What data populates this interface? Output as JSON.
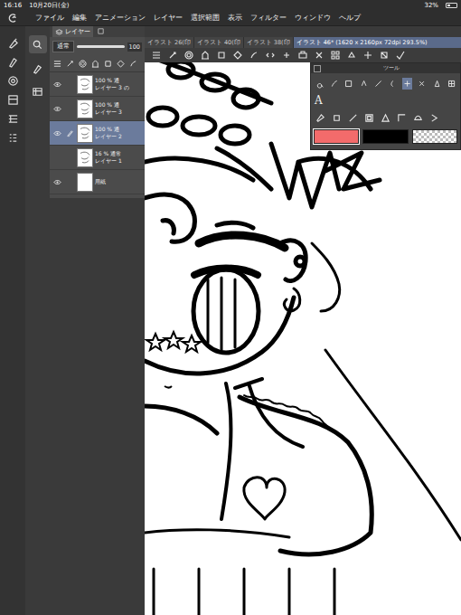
{
  "status_bar": {
    "time": "16:16",
    "date": "10月20日(金)",
    "battery": "32%",
    "battery_level": 0.32
  },
  "menu": [
    "ファイル",
    "編集",
    "アニメーション",
    "レイヤー",
    "選択範囲",
    "表示",
    "フィルター",
    "ウィンドウ",
    "ヘルプ"
  ],
  "layer_panel": {
    "tab": "レイヤー",
    "blend_mode": "通常",
    "opacity": "100",
    "layers": [
      {
        "kind": "raster",
        "opacity": "100 %",
        "mode": "通",
        "name": "レイヤー 3 の",
        "visible": true,
        "selected": false,
        "editing": false
      },
      {
        "kind": "raster",
        "opacity": "100 %",
        "mode": "通",
        "name": "レイヤー 3",
        "visible": true,
        "selected": false,
        "editing": false
      },
      {
        "kind": "raster",
        "opacity": "100 %",
        "mode": "通",
        "name": "レイヤー 2",
        "visible": true,
        "selected": true,
        "editing": true
      },
      {
        "kind": "raster",
        "opacity": "16 %",
        "mode": "通常",
        "name": "レイヤー 1",
        "visible": false,
        "selected": false,
        "editing": false
      },
      {
        "kind": "paper",
        "opacity": "",
        "mode": "",
        "name": "用紙",
        "visible": true,
        "selected": false,
        "editing": false
      }
    ]
  },
  "document_tabs": [
    {
      "label": "イラスト 26(印",
      "selected": false
    },
    {
      "label": "イラスト 40(印",
      "selected": false
    },
    {
      "label": "イラスト 38(印",
      "selected": false
    },
    {
      "label": "イラスト 46* (1620 x 2160px 72dpi 293.5%)",
      "selected": true
    }
  ],
  "tool_palette": {
    "title": "ツール",
    "text_tool": "A",
    "colors": [
      {
        "name": "main",
        "color": "#f36b6b",
        "selected": true
      },
      {
        "name": "sub",
        "color": "#000000",
        "selected": false
      },
      {
        "name": "transparent",
        "color": "transparent",
        "selected": false
      }
    ]
  }
}
